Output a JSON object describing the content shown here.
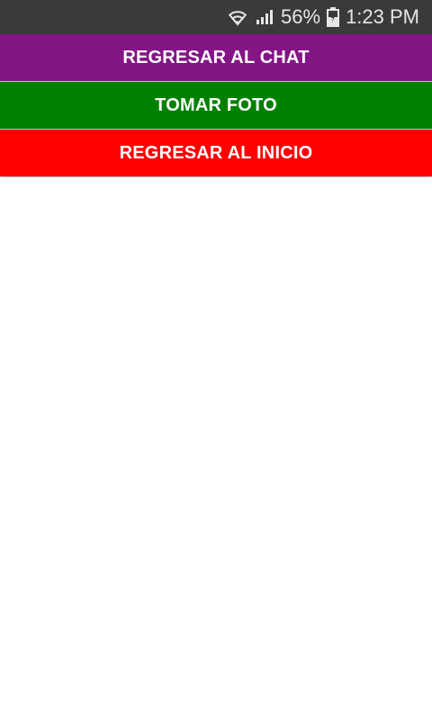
{
  "status_bar": {
    "battery_percent": "56%",
    "time": "1:23 PM",
    "icons": [
      "wifi-icon",
      "signal-icon",
      "battery-icon"
    ],
    "background": "#3a3a3a"
  },
  "buttons": {
    "chat": {
      "label": "REGRESAR AL CHAT",
      "color": "#841585"
    },
    "photo": {
      "label": "TOMAR FOTO",
      "color": "#008000"
    },
    "home": {
      "label": "REGRESAR AL INICIO",
      "color": "#ff0000"
    }
  }
}
